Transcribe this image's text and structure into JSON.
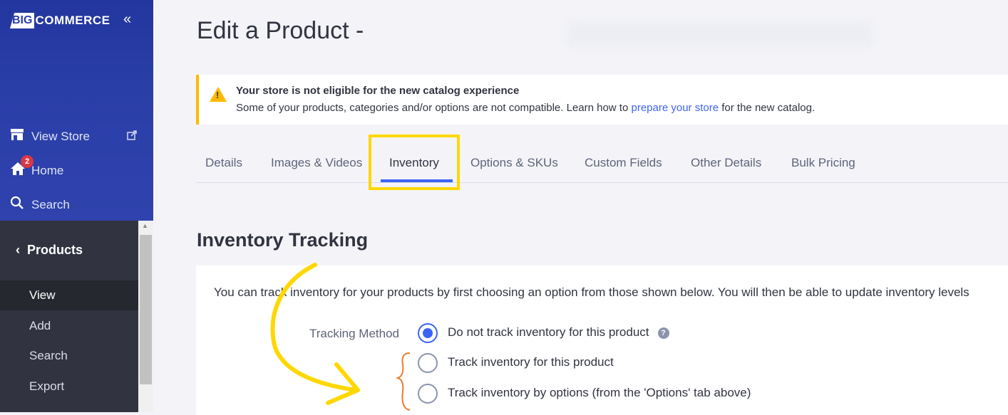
{
  "sidebar": {
    "logo_big": "BIG",
    "logo_rest": "COMMERCE",
    "collapse_icon": "«",
    "view_store": "View Store",
    "home": "Home",
    "home_badge": "2",
    "search": "Search",
    "section": "Products",
    "sub_items": [
      {
        "label": "View"
      },
      {
        "label": "Add"
      },
      {
        "label": "Search"
      },
      {
        "label": "Export"
      }
    ]
  },
  "page": {
    "title": "Edit a Product -"
  },
  "alert": {
    "title": "Your store is not eligible for the new catalog experience",
    "text_before": "Some of your products, categories and/or options are not compatible. Learn how to ",
    "link": "prepare your store",
    "text_after": " for the new catalog."
  },
  "tabs": [
    {
      "label": "Details"
    },
    {
      "label": "Images & Videos"
    },
    {
      "label": "Inventory"
    },
    {
      "label": "Options & SKUs"
    },
    {
      "label": "Custom Fields"
    },
    {
      "label": "Other Details"
    },
    {
      "label": "Bulk Pricing"
    }
  ],
  "active_tab": "Inventory",
  "inventory": {
    "section_title": "Inventory Tracking",
    "description": "You can track inventory for your products by first choosing an option from those shown below. You will then be able to update inventory levels",
    "tracking_label": "Tracking Method",
    "options": [
      {
        "label": "Do not track inventory for this product",
        "checked": true
      },
      {
        "label": "Track inventory for this product",
        "checked": false
      },
      {
        "label": "Track inventory by options (from the 'Options' tab above)",
        "checked": false
      }
    ]
  },
  "colors": {
    "accent": "#3c64f4",
    "sidebar": "#2a3ea8",
    "warning": "#ffb800",
    "annotation": "#ffd700",
    "bracket": "#f07b2c"
  }
}
